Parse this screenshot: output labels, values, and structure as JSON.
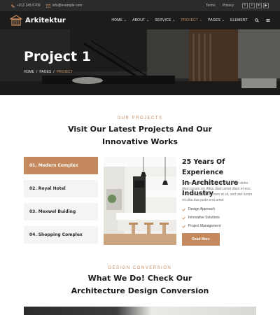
{
  "topbar": {
    "phone": "+012 345 6789",
    "email": "info@example.com",
    "links": [
      "Terms",
      "Privacy"
    ],
    "social_icons": [
      "facebook-icon",
      "twitter-icon",
      "linkedin-icon",
      "youtube-icon"
    ]
  },
  "nav": {
    "brand": "Arkitektur",
    "menu": [
      {
        "label": "HOME",
        "caret": true,
        "active": false
      },
      {
        "label": "ABOUT",
        "caret": true,
        "active": false
      },
      {
        "label": "SERVICE",
        "caret": true,
        "active": false
      },
      {
        "label": "PROJECT",
        "caret": true,
        "active": true
      },
      {
        "label": "PAGES",
        "caret": true,
        "active": false
      },
      {
        "label": "ELEMENT",
        "caret": false,
        "active": false
      }
    ],
    "accent": "#c48a5e"
  },
  "hero": {
    "title": "Project 1",
    "breadcrumb": [
      "HOME",
      "PAGES",
      "PROJECT"
    ]
  },
  "projects": {
    "eyebrow": "OUR PROJECTS",
    "title_line1": "Visit Our Latest Projects And Our",
    "title_line2": "Innovative Works",
    "tabs": [
      {
        "label": "01. Modern Complex",
        "active": true
      },
      {
        "label": "02. Royal Hotel",
        "active": false
      },
      {
        "label": "03. Mexwel Buiding",
        "active": false
      },
      {
        "label": "04. Shopping Complex",
        "active": false
      }
    ],
    "exp_title_line1": "25 Years Of Experience",
    "exp_title_line2": "In Architecture Industry",
    "exp_text": "Tempor erat elitr rebum at clita. Diam dolor diam ipsum sit. Aliqu diam amet diam et eos. Clita erat ipsum et lorem et sit, sed stet lorem sit clita duo justo erat amet",
    "checks": [
      "Design Approach",
      "Innovative Solutions",
      "Project Management"
    ],
    "read_more": "Read More"
  },
  "conversion": {
    "eyebrow": "DESIGN CONVERSION",
    "title_line1": "What We Do! Check Our",
    "title_line2": "Architecture Design Conversion"
  }
}
